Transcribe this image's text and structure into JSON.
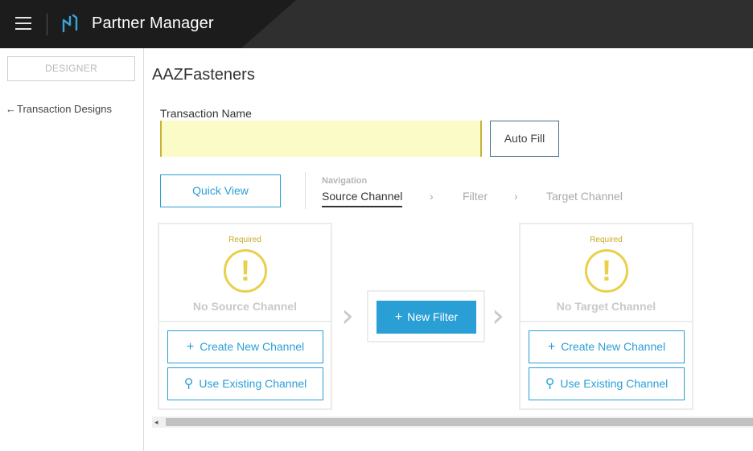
{
  "header": {
    "app_title": "Partner Manager",
    "menu_icon": "hamburger-icon",
    "logo_icon": "partner-manager-logo-icon"
  },
  "sidebar": {
    "designer_label": "DESIGNER",
    "back_arrow": "←",
    "back_link": "Transaction Designs"
  },
  "main": {
    "page_title": "AAZFasteners",
    "transaction_name_label": "Transaction Name",
    "transaction_name_value": "",
    "auto_fill_label": "Auto Fill",
    "quick_view_label": "Quick View",
    "navigation": {
      "heading": "Navigation",
      "steps": [
        "Source Channel",
        "Filter",
        "Target Channel"
      ],
      "active_step": "Source Channel",
      "chevron": "›"
    },
    "source_panel": {
      "required_label": "Required",
      "warning_glyph": "!",
      "empty_text": "No Source Channel",
      "create_label": "Create New Channel",
      "use_existing_label": "Use Existing Channel"
    },
    "filter": {
      "new_filter_label": "New Filter"
    },
    "target_panel": {
      "required_label": "Required",
      "warning_glyph": "!",
      "empty_text": "No Target Channel",
      "create_label": "Create New Channel",
      "use_existing_label": "Use Existing Channel"
    },
    "flow_chevron": "›",
    "plus_glyph": "+",
    "search_glyph": "⚲",
    "scroll_left_glyph": "◂"
  },
  "colors": {
    "accent": "#2a9fd6",
    "required": "#c8a825",
    "warning": "#e8d04a",
    "input_highlight": "#fbfbc7",
    "header_bg": "#2f2f2f"
  }
}
